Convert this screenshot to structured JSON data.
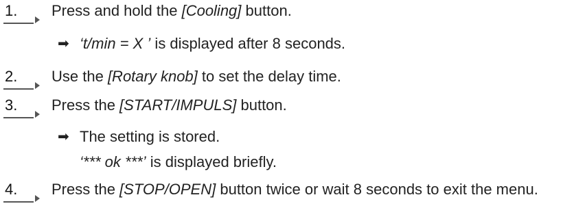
{
  "steps": [
    {
      "number": "1.",
      "parts": [
        "Press and hold the ",
        "[Cooling]",
        " button."
      ]
    },
    {
      "number": "2.",
      "parts": [
        "Use the ",
        "[Rotary knob]",
        " to set the delay time."
      ]
    },
    {
      "number": "3.",
      "parts": [
        "Press the ",
        "[START/IMPULS]",
        " button."
      ]
    },
    {
      "number": "4.",
      "parts": [
        "Press the ",
        "[STOP/OPEN]",
        " button twice or wait 8 seconds to exit the menu."
      ]
    }
  ],
  "results": [
    {
      "arrow": "➡",
      "parts": [
        "‘t/min = X ’",
        " is displayed after 8 seconds."
      ]
    },
    {
      "arrow": "➡",
      "parts": [
        "The setting is stored."
      ]
    },
    {
      "parts": [
        "‘*** ok ***’",
        " is displayed briefly."
      ]
    }
  ]
}
